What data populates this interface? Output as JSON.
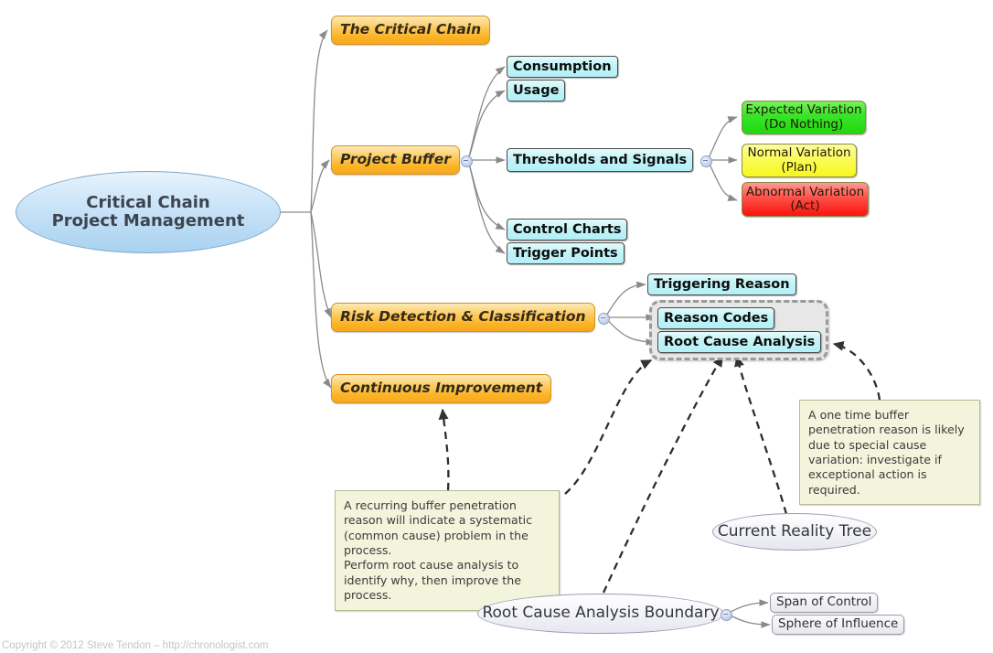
{
  "diagram": {
    "title": "Critical Chain Project Management",
    "root": {
      "label": "Critical Chain\nProject Management"
    },
    "branches": {
      "critical_chain": "The Critical Chain",
      "project_buffer": "Project Buffer",
      "risk_detection": "Risk Detection & Classification",
      "continuous_improvement": "Continuous Improvement"
    },
    "project_buffer_children": {
      "consumption": "Consumption",
      "usage": "Usage",
      "thresholds": "Thresholds and Signals",
      "control_charts": "Control Charts",
      "trigger_points": "Trigger Points"
    },
    "variations": [
      {
        "name": "Expected Variation",
        "action": "(Do Nothing)",
        "color": "#21d80f"
      },
      {
        "name": "Normal Variation",
        "action": "(Plan)",
        "color": "#f7f71e"
      },
      {
        "name": "Abnormal Variation",
        "action": "(Act)",
        "color": "#fb120c"
      }
    ],
    "risk_children": {
      "triggering_reason": "Triggering Reason",
      "reason_codes": "Reason Codes",
      "root_cause_analysis": "Root Cause Analysis"
    },
    "notes": {
      "recurring": "A recurring buffer penetration reason will indicate a systematic (common cause) problem in the process.\nPerform root cause analysis to identify why, then improve the process.",
      "one_time": "A one time buffer penetration reason is likely due to special cause variation: investigate if exceptional action is required."
    },
    "floating": {
      "current_reality_tree": "Current Reality Tree",
      "rca_boundary": "Root Cause Analysis Boundary",
      "span_of_control": "Span of Control",
      "sphere_of_influence": "Sphere of Influence"
    },
    "footer": "Copyright © 2012 Steve Tendon – http://chronologist.com"
  }
}
